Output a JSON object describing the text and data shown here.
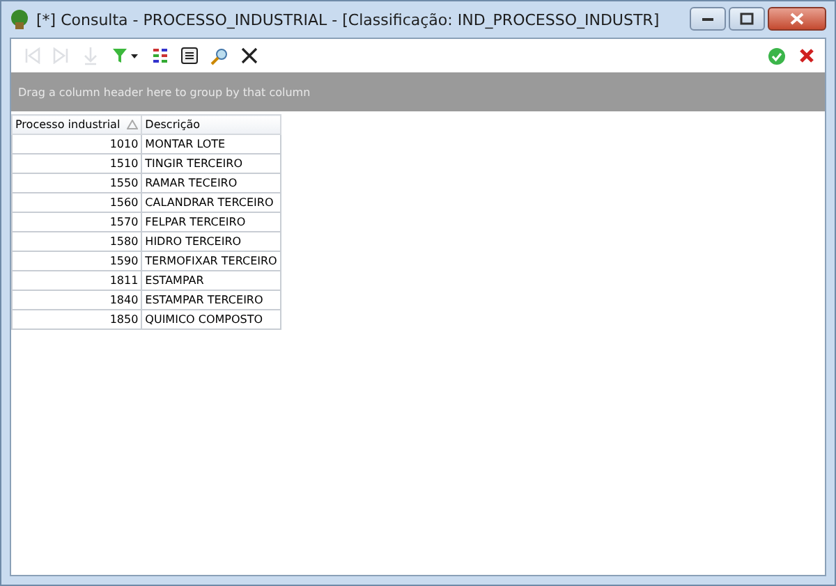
{
  "window": {
    "title": "[*] Consulta - PROCESSO_INDUSTRIAL - [Classificação: IND_PROCESSO_INDUSTR]"
  },
  "toolbar": [
    {
      "kind": "first",
      "disabled": true
    },
    {
      "kind": "last",
      "disabled": true
    },
    {
      "kind": "down",
      "disabled": true
    },
    {
      "kind": "filter",
      "disabled": false
    },
    {
      "kind": "columns",
      "disabled": false
    },
    {
      "kind": "form",
      "disabled": false
    },
    {
      "kind": "search",
      "disabled": false
    },
    {
      "kind": "clear",
      "disabled": false
    }
  ],
  "group_panel": {
    "text": "Drag a column header here to group by that column"
  },
  "table": {
    "columns": [
      {
        "label": "Processo industrial",
        "sorted": true
      },
      {
        "label": "Descrição",
        "sorted": false
      }
    ],
    "rows": [
      [
        "1010",
        "MONTAR LOTE"
      ],
      [
        "1510",
        "TINGIR TERCEIRO"
      ],
      [
        "1550",
        "RAMAR TECEIRO"
      ],
      [
        "1560",
        "CALANDRAR TERCEIRO"
      ],
      [
        "1570",
        "FELPAR TERCEIRO"
      ],
      [
        "1580",
        "HIDRO TERCEIRO"
      ],
      [
        "1590",
        "TERMOFIXAR TERCEIRO"
      ],
      [
        "1811",
        "ESTAMPAR"
      ],
      [
        "1840",
        "ESTAMPAR TERCEIRO"
      ],
      [
        "1850",
        "QUIMICO COMPOSTO"
      ]
    ]
  }
}
